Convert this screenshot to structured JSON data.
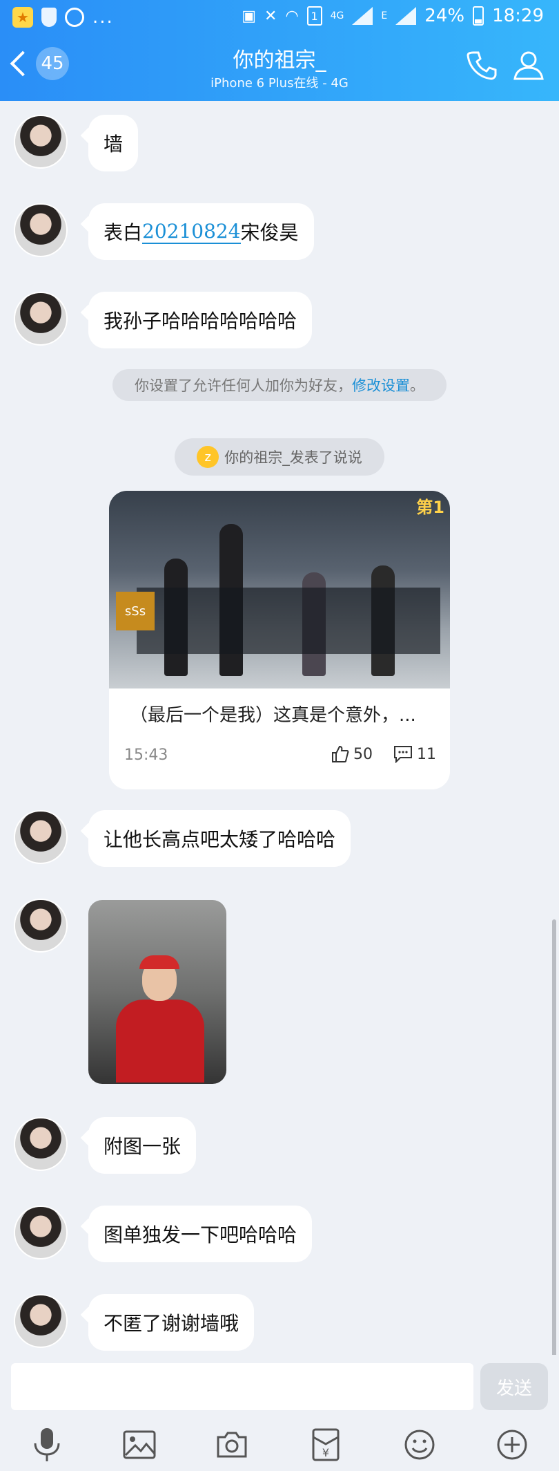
{
  "status_bar": {
    "network": "4G",
    "data_type": "E",
    "sim_slot": "1",
    "battery": "24%",
    "time": "18:29",
    "overflow": "..."
  },
  "header": {
    "unread_count": "45",
    "title": "你的祖宗_",
    "subtitle": "iPhone 6 Plus在线 - 4G"
  },
  "messages": [
    {
      "text": "墙"
    },
    {
      "text_before": "表白",
      "link": "20210824",
      "text_after": "宋俊昊"
    },
    {
      "text": "我孙子哈哈哈哈哈哈哈"
    }
  ],
  "system_tip": {
    "text": "你设置了允许任何人加你为好友，",
    "link": "修改设置",
    "end": "。"
  },
  "activity_tip": {
    "text": "你的祖宗_发表了说说"
  },
  "share_card": {
    "rank_text": "第1",
    "grade": "sSs",
    "title": "（最后一个是我）这真是个意外，...",
    "time": "15:43",
    "likes": "50",
    "comments": "11"
  },
  "messages_after": [
    {
      "text": "让他长高点吧太矮了哈哈哈"
    },
    {
      "text": "附图一张"
    },
    {
      "text": "图单独发一下吧哈哈哈"
    },
    {
      "text": "不匿了谢谢墙哦"
    }
  ],
  "input": {
    "value": "",
    "send_label": "发送"
  },
  "colors": {
    "header_start": "#2a8ef7",
    "header_end": "#37b6fb",
    "link": "#1a8fd6",
    "background": "#eef1f6"
  },
  "icons": [
    "back-chevron-icon",
    "phone-icon",
    "profile-icon",
    "microphone-icon",
    "image-icon",
    "camera-icon",
    "red-packet-icon",
    "emoji-icon",
    "plus-icon"
  ]
}
